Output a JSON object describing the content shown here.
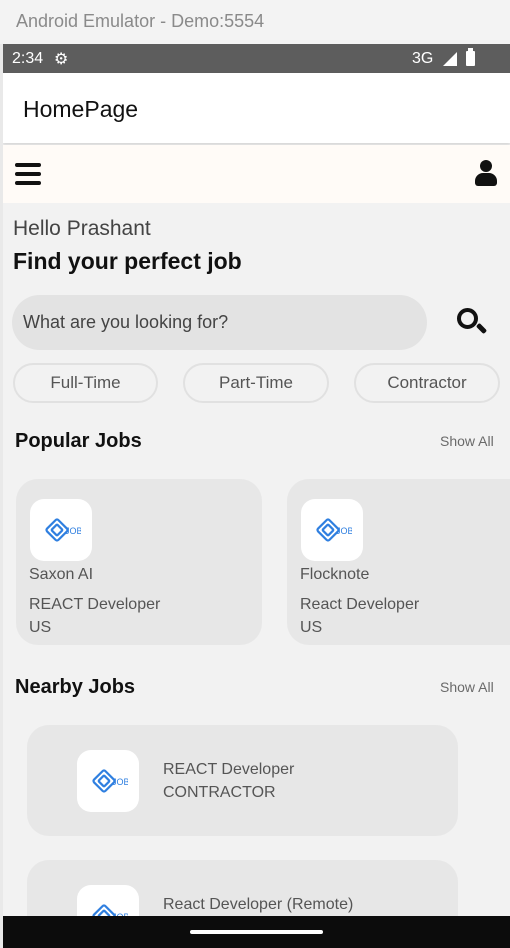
{
  "window": {
    "title": "Android Emulator - Demo:5554"
  },
  "status_bar": {
    "time": "2:34",
    "network": "3G",
    "icons": [
      "gear-icon",
      "signal-icon",
      "battery-icon"
    ]
  },
  "app_bar": {
    "title": "HomePage"
  },
  "header": {
    "menu_icon": "hamburger-menu-icon",
    "profile_icon": "user-icon"
  },
  "greeting": {
    "hello": "Hello Prashant",
    "headline": "Find your perfect job"
  },
  "search": {
    "placeholder": "What are you looking for?",
    "icon": "search-icon"
  },
  "job_types": [
    "Full-Time",
    "Part-Time",
    "Contractor"
  ],
  "popular_jobs": {
    "title": "Popular Jobs",
    "show_all": "Show All",
    "items": [
      {
        "company": "Saxon AI",
        "role": "REACT Developer",
        "location": "US",
        "logo_text": "JOB"
      },
      {
        "company": "Flocknote",
        "role": "React Developer",
        "location": "US",
        "logo_text": "JOB"
      }
    ]
  },
  "nearby_jobs": {
    "title": "Nearby Jobs",
    "show_all": "Show All",
    "items": [
      {
        "title": "REACT Developer",
        "type": "CONTRACTOR",
        "logo_text": "JOB"
      },
      {
        "title": "React Developer (Remote)",
        "type": "",
        "logo_text": "JOB"
      }
    ]
  },
  "colors": {
    "logo_blue": "#2f7fe0",
    "card_bg": "#e7e7e7",
    "header_bg": "#fffbf7"
  }
}
